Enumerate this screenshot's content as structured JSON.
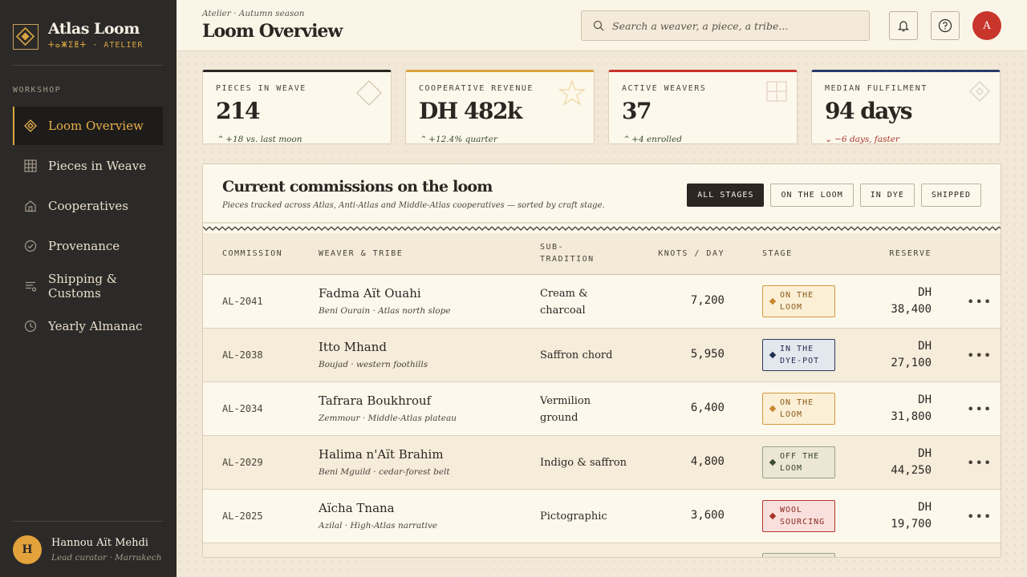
{
  "brand": {
    "name": "Atlas Loom",
    "subtitle": "ⵜⴰⵥⵉⵟⵜ · ATELIER",
    "accent": "#d9a441"
  },
  "sidebar": {
    "section": "WORKSHOP",
    "items": [
      {
        "label": "Loom Overview",
        "icon": "diamond-icon",
        "active": true
      },
      {
        "label": "Pieces in Weave",
        "icon": "grid-icon"
      },
      {
        "label": "Cooperatives",
        "icon": "house-icon"
      },
      {
        "label": "Provenance",
        "icon": "check-circle-icon"
      },
      {
        "label": "Shipping & Customs",
        "icon": "list-icon"
      },
      {
        "label": "Yearly Almanac",
        "icon": "clock-icon"
      }
    ],
    "user": {
      "initial": "H",
      "name": "Hannou Aït Mehdi",
      "role": "Lead curator · Marrakech"
    }
  },
  "header": {
    "crumb": "Atelier · Autumn season",
    "title": "Loom Overview",
    "search_placeholder": "Search a weaver, a piece, a tribe...",
    "avatar": "A"
  },
  "kpis": [
    {
      "label": "PIECES IN WEAVE",
      "value": "214",
      "delta": "+18 vs. last moon",
      "direction": "up",
      "color": "#2b2622",
      "icon": "diamond-outline-icon"
    },
    {
      "label": "COOPERATIVE REVENUE",
      "value": "DH 482k",
      "delta": "+12.4% quarter",
      "direction": "up",
      "color": "#d9a441",
      "icon": "star-icon"
    },
    {
      "label": "ACTIVE WEAVERS",
      "value": "37",
      "delta": "+4 enrolled",
      "direction": "up",
      "color": "#c8352b",
      "icon": "grid-outline-icon"
    },
    {
      "label": "MEDIAN FULFILMENT",
      "value": "94 days",
      "delta": "−6 days, faster",
      "direction": "down",
      "color": "#2b3a6c",
      "icon": "diamond-dot-icon"
    }
  ],
  "panel": {
    "title": "Current commissions on the loom",
    "subtitle": "Pieces tracked across Atlas, Anti-Atlas and Middle-Atlas cooperatives — sorted by craft stage.",
    "filters": [
      "ALL STAGES",
      "ON THE LOOM",
      "IN DYE",
      "SHIPPED"
    ],
    "columns": {
      "commission": "COMMISSION",
      "weaver": "WEAVER & TRIBE",
      "sub_1": "SUB-",
      "sub_2": "TRADITION",
      "knots": "KNOTS / DAY",
      "stage": "STAGE",
      "reserve": "RESERVE"
    },
    "rows": [
      {
        "id": "AL-2041",
        "weaver": "Fadma Aït Ouahi",
        "tribe": "Beni Ourain · Atlas north slope",
        "sub_1": "Cream &",
        "sub_2": "charcoal",
        "knots": "7,200",
        "stage_1": "ON THE",
        "stage_2": "LOOM",
        "stage_kind": "loom",
        "reserve_1": "DH",
        "reserve_2": "38,400"
      },
      {
        "id": "AL-2038",
        "weaver": "Itto Mhand",
        "tribe": "Boujad · western foothills",
        "sub_1": "Saffron chord",
        "sub_2": "",
        "knots": "5,950",
        "stage_1": "IN THE",
        "stage_2": "DYE-POT",
        "stage_kind": "dye",
        "reserve_1": "DH",
        "reserve_2": "27,100"
      },
      {
        "id": "AL-2034",
        "weaver": "Tafrara Boukhrouf",
        "tribe": "Zemmour · Middle-Atlas plateau",
        "sub_1": "Vermilion",
        "sub_2": "ground",
        "knots": "6,400",
        "stage_1": "ON THE",
        "stage_2": "LOOM",
        "stage_kind": "loom",
        "reserve_1": "DH",
        "reserve_2": "31,800"
      },
      {
        "id": "AL-2029",
        "weaver": "Halima n'Aït Brahim",
        "tribe": "Beni Mguild · cedar-forest belt",
        "sub_1": "Indigo & saffron",
        "sub_2": "",
        "knots": "4,800",
        "stage_1": "OFF THE",
        "stage_2": "LOOM",
        "stage_kind": "off",
        "reserve_1": "DH",
        "reserve_2": "44,250"
      },
      {
        "id": "AL-2025",
        "weaver": "Aïcha Tnana",
        "tribe": "Azilal · High-Atlas narrative",
        "sub_1": "Pictographic",
        "sub_2": "",
        "knots": "3,600",
        "stage_1": "WOOL",
        "stage_2": "SOURCING",
        "stage_kind": "wool",
        "reserve_1": "DH",
        "reserve_2": "19,700"
      }
    ]
  }
}
